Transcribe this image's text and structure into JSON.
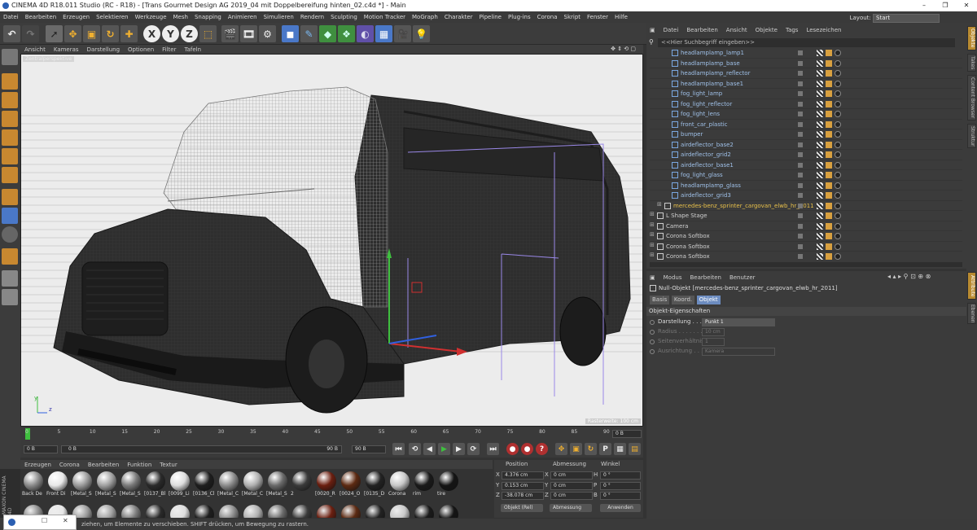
{
  "window": {
    "title": "CINEMA 4D R18.011 Studio (RC - R18) - [Trans Gourmet Design AG 2019_04 mit Doppelbereifung hinten_02.c4d *] - Main",
    "minimize": "–",
    "maximize": "❐",
    "close": "✕"
  },
  "menubar": {
    "items": [
      "Datei",
      "Bearbeiten",
      "Erzeugen",
      "Selektieren",
      "Werkzeuge",
      "Mesh",
      "Snapping",
      "Animieren",
      "Simulieren",
      "Rendern",
      "Sculpting",
      "Motion Tracker",
      "MoGraph",
      "Charakter",
      "Pipeline",
      "Plug-ins",
      "Corona",
      "Skript",
      "Fenster",
      "Hilfe"
    ],
    "layout_label": "Layout:",
    "layout_value": "Start"
  },
  "toolbar": {
    "axis_x": "X",
    "axis_y": "Y",
    "axis_z": "Z"
  },
  "viewport": {
    "menu": [
      "Ansicht",
      "Kameras",
      "Darstellung",
      "Optionen",
      "Filter",
      "Tafeln"
    ],
    "label": "Zentralperspektive",
    "axis_y": "y",
    "axis_z": "z",
    "grid_label": "Rasterweite: 100 cm"
  },
  "timeline": {
    "ticks": [
      "0",
      "5",
      "10",
      "15",
      "20",
      "25",
      "30",
      "35",
      "40",
      "45",
      "50",
      "55",
      "60",
      "65",
      "70",
      "75",
      "80",
      "85",
      "90"
    ],
    "frame_field": "0 B",
    "start_field": "0 B",
    "current_field": "0 B",
    "end_field": "90 B",
    "max_field": "90 B"
  },
  "materials": {
    "menu": [
      "Erzeugen",
      "Corona",
      "Bearbeiten",
      "Funktion",
      "Textur"
    ],
    "items": [
      {
        "label": "Back De",
        "color": "#8a8a8a"
      },
      {
        "label": "Front Di",
        "color": "#e8e8e8"
      },
      {
        "label": "[Metal_S",
        "color": "#9a9a9a"
      },
      {
        "label": "[Metal_S",
        "color": "#a0a0a0"
      },
      {
        "label": "[Metal_S",
        "color": "#7a7a7a"
      },
      {
        "label": "[0137_Bl",
        "color": "#2a2a2a"
      },
      {
        "label": "[0099_Li",
        "color": "#dddddd"
      },
      {
        "label": "[0136_Cl",
        "color": "#1e1e1e"
      },
      {
        "label": "[Metal_C",
        "color": "#8c8c8c"
      },
      {
        "label": "[Metal_C",
        "color": "#b0b0b0"
      },
      {
        "label": "[Metal_S",
        "color": "#6a6a6a"
      },
      {
        "label": "2",
        "color": "#3a3a3a"
      },
      {
        "label": "[0020_R",
        "color": "#6b1f10"
      },
      {
        "label": "[0024_O",
        "color": "#5c2a12"
      },
      {
        "label": "[0135_D",
        "color": "#222222"
      },
      {
        "label": "Corona",
        "color": "#c8c8c8"
      },
      {
        "label": "rim",
        "color": "#1a1a1a"
      },
      {
        "label": "tire",
        "color": "#151515"
      }
    ],
    "maxon_label": "MAXON CINEMA 4D"
  },
  "coordinates": {
    "col_position": "Position",
    "col_size": "Abmessung",
    "col_rotation": "Winkel",
    "rows": [
      {
        "axis": "X",
        "pos": "4.376 cm",
        "size_axis": "X",
        "size": "0 cm",
        "rot_axis": "H",
        "rot": "0 °"
      },
      {
        "axis": "Y",
        "pos": "0.153 cm",
        "size_axis": "Y",
        "size": "0 cm",
        "rot_axis": "P",
        "rot": "0 °"
      },
      {
        "axis": "Z",
        "pos": "-38.078 cm",
        "size_axis": "Z",
        "size": "0 cm",
        "rot_axis": "B",
        "rot": "0 °"
      }
    ],
    "mode_select": "Objekt (Rel)",
    "size_select": "Abmessung",
    "apply_button": "Anwenden"
  },
  "status": {
    "text": "ziehen, um Elemente zu verschieben. SHIFT drücken, um Bewegung zu rastern."
  },
  "object_manager": {
    "menu": [
      "Datei",
      "Bearbeiten",
      "Ansicht",
      "Objekte",
      "Tags",
      "Lesezeichen"
    ],
    "search_placeholder": "<<Hier Suchbegriff eingeben>>",
    "rows": [
      {
        "name": "headlamplamp_lamp1",
        "indent": 2,
        "color": "#9fc0e8"
      },
      {
        "name": "headlamplamp_base",
        "indent": 2,
        "color": "#9fc0e8"
      },
      {
        "name": "headlamplamp_reflector",
        "indent": 2,
        "color": "#9fc0e8"
      },
      {
        "name": "headlamplamp_base1",
        "indent": 2,
        "color": "#9fc0e8"
      },
      {
        "name": "fog_light_lamp",
        "indent": 2,
        "color": "#9fc0e8"
      },
      {
        "name": "fog_light_reflector",
        "indent": 2,
        "color": "#9fc0e8"
      },
      {
        "name": "fog_light_lens",
        "indent": 2,
        "color": "#9fc0e8"
      },
      {
        "name": "front_car_plastic",
        "indent": 2,
        "color": "#9fc0e8"
      },
      {
        "name": "bumper",
        "indent": 2,
        "color": "#9fc0e8"
      },
      {
        "name": "airdeflector_base2",
        "indent": 2,
        "color": "#9fc0e8"
      },
      {
        "name": "airdeflector_grid2",
        "indent": 2,
        "color": "#9fc0e8"
      },
      {
        "name": "airdeflector_base1",
        "indent": 2,
        "color": "#9fc0e8"
      },
      {
        "name": "fog_light_glass",
        "indent": 2,
        "color": "#9fc0e8"
      },
      {
        "name": "headlamplamp_glass",
        "indent": 2,
        "color": "#9fc0e8"
      },
      {
        "name": "airdeflector_grid3",
        "indent": 2,
        "color": "#9fc0e8"
      },
      {
        "name": "mercedes-benz_sprinter_cargovan_elwb_hr_2011",
        "indent": 1,
        "color": "#e8c04a"
      },
      {
        "name": "L Shape Stage",
        "indent": 0,
        "color": "#cfcfcf"
      },
      {
        "name": "Camera",
        "indent": 0,
        "color": "#cfcfcf"
      },
      {
        "name": "Corona Softbox",
        "indent": 0,
        "color": "#cfcfcf"
      },
      {
        "name": "Corona Softbox",
        "indent": 0,
        "color": "#cfcfcf"
      },
      {
        "name": "Corona Softbox",
        "indent": 0,
        "color": "#cfcfcf"
      }
    ]
  },
  "attribute_manager": {
    "menu": [
      "Modus",
      "Bearbeiten",
      "Benutzer"
    ],
    "object_title": "Null-Objekt [mercedes-benz_sprinter_cargovan_elwb_hr_2011]",
    "tabs": [
      "Basis",
      "Koord.",
      "Objekt"
    ],
    "section": "Objekt-Eigenschaften",
    "props": [
      {
        "label": "Darstellung . . . .",
        "value": "Punkt 1"
      },
      {
        "label": "Radius . . . . . . . .",
        "value": "10 cm"
      },
      {
        "label": "Seitenverhältnis",
        "value": "1"
      },
      {
        "label": "Ausrichtung . . . .",
        "value": "Kamera"
      }
    ]
  },
  "side_tabs": [
    "Objekte",
    "Takes",
    "Content Browser",
    "Struktur",
    "Attribute",
    "Ebenen"
  ]
}
